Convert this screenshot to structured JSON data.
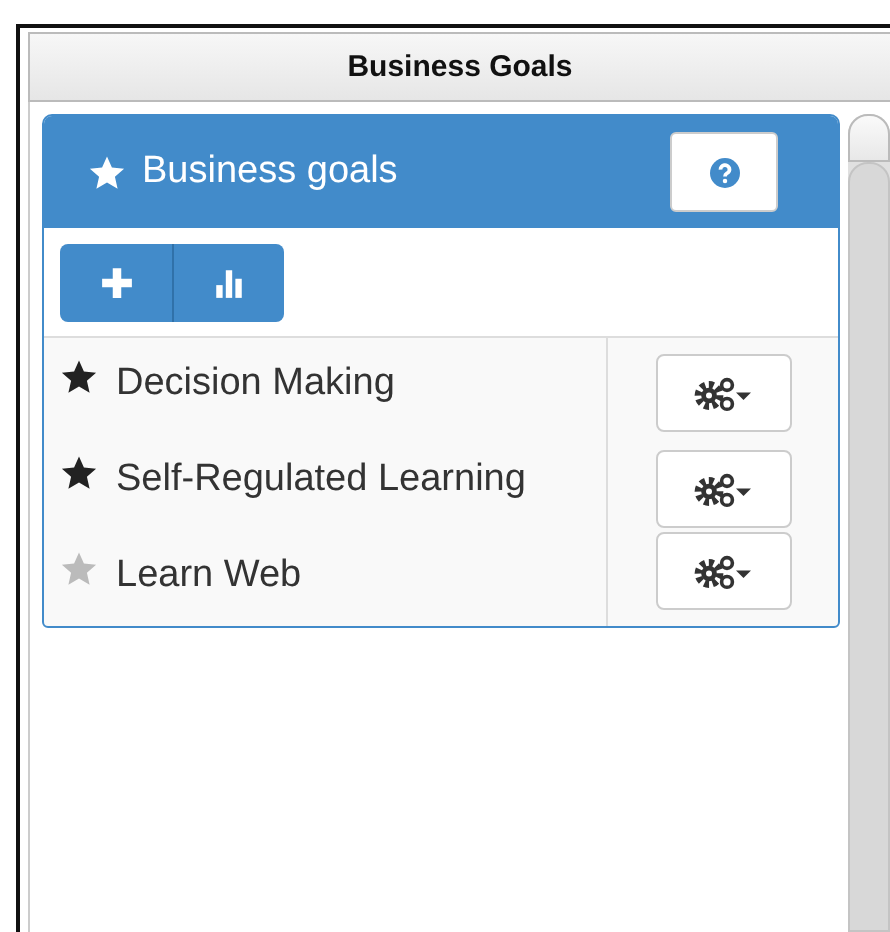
{
  "window": {
    "title": "Business Goals"
  },
  "panel": {
    "title": "Business goals"
  },
  "goals": [
    {
      "label": "Decision Making",
      "starred": true
    },
    {
      "label": "Self-Regulated Learning",
      "starred": true
    },
    {
      "label": "Learn Web",
      "starred": false
    }
  ]
}
